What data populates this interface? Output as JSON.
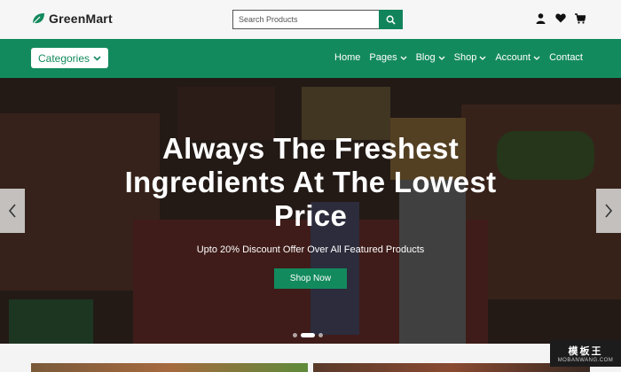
{
  "brand": {
    "name": "GreenMart",
    "accent": "#138a5e"
  },
  "search": {
    "placeholder": "Search Products"
  },
  "header_icons": [
    "user-icon",
    "heart-icon",
    "cart-icon"
  ],
  "nav": {
    "categories_label": "Categories",
    "items": [
      {
        "label": "Home",
        "has_dropdown": false
      },
      {
        "label": "Pages",
        "has_dropdown": true
      },
      {
        "label": "Blog",
        "has_dropdown": true
      },
      {
        "label": "Shop",
        "has_dropdown": true
      },
      {
        "label": "Account",
        "has_dropdown": true
      },
      {
        "label": "Contact",
        "has_dropdown": false
      }
    ]
  },
  "hero": {
    "title": "Always The Freshest Ingredients At The Lowest Price",
    "subtitle": "Upto 20% Discount Offer Over All Featured Products",
    "cta_label": "Shop Now",
    "slides_count": 3,
    "active_slide": 1
  },
  "watermark": {
    "main": "模板王",
    "url": "MOBANWANG.COM"
  }
}
